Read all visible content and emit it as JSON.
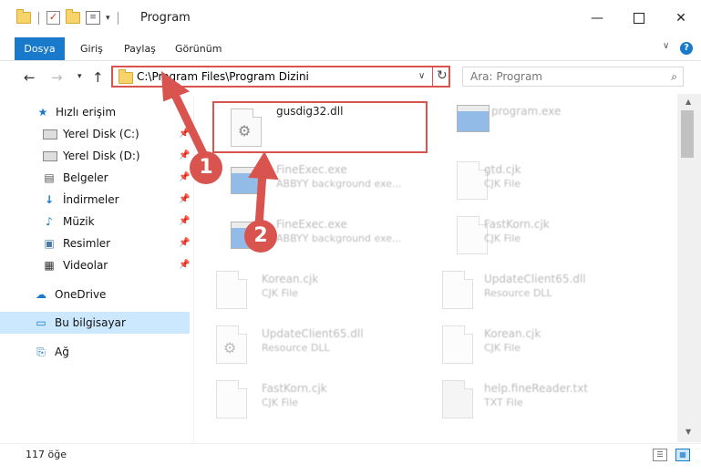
{
  "window": {
    "title": "Program"
  },
  "ribbon": {
    "tabs": [
      "Dosya",
      "Giriş",
      "Paylaş",
      "Görünüm"
    ]
  },
  "navbar": {
    "address": "C:\\Program Files\\Program Dizini",
    "search_placeholder": "Ara: Program"
  },
  "sidebar": {
    "items": [
      {
        "label": "Hızlı erişim",
        "icon": "star-icon",
        "pinned": false
      },
      {
        "label": "Yerel Disk (C:)",
        "icon": "drive-icon",
        "pinned": true
      },
      {
        "label": "Yerel Disk (D:)",
        "icon": "drive-icon",
        "pinned": true
      },
      {
        "label": "Belgeler",
        "icon": "documents-icon",
        "pinned": true
      },
      {
        "label": "İndirmeler",
        "icon": "download-icon",
        "pinned": true
      },
      {
        "label": "Müzik",
        "icon": "music-icon",
        "pinned": true
      },
      {
        "label": "Resimler",
        "icon": "pictures-icon",
        "pinned": true
      },
      {
        "label": "Videolar",
        "icon": "videos-icon",
        "pinned": true
      },
      {
        "label": "OneDrive",
        "icon": "cloud-icon",
        "pinned": false
      },
      {
        "label": "Bu bilgisayar",
        "icon": "computer-icon",
        "pinned": false,
        "selected": true
      },
      {
        "label": "Ağ",
        "icon": "network-icon",
        "pinned": false
      }
    ]
  },
  "files": [
    {
      "name": "gusdig32.dll",
      "desc": "",
      "type": "dll"
    },
    {
      "name": "program.exe",
      "desc": "",
      "type": "exe"
    },
    {
      "name": "FineExec.exe",
      "desc": "ABBYY background exe...",
      "type": "exe"
    },
    {
      "name": "gtd.cjk",
      "desc": "CJK File",
      "type": "file"
    },
    {
      "name": "FineExec.exe",
      "desc": "ABBYY background exe...",
      "type": "exe"
    },
    {
      "name": "FastKorn.cjk",
      "desc": "CJK File",
      "type": "file"
    },
    {
      "name": "Korean.cjk",
      "desc": "CJK File",
      "type": "file"
    },
    {
      "name": "UpdateClient65.dll",
      "desc": "Resource DLL",
      "type": "file"
    },
    {
      "name": "UpdateClient65.dll",
      "desc": "Resource DLL",
      "type": "dll"
    },
    {
      "name": "Korean.cjk",
      "desc": "CJK File",
      "type": "file"
    },
    {
      "name": "FastKorn.cjk",
      "desc": "CJK File",
      "type": "file"
    },
    {
      "name": "help.fineReader.txt",
      "desc": "TXT File",
      "type": "file"
    }
  ],
  "status": {
    "count": "117 öğe"
  },
  "annotations": {
    "badge1": "1",
    "badge2": "2",
    "color": "#d9534f"
  },
  "colors": {
    "accent": "#1979ca",
    "selected": "#cce8ff"
  }
}
